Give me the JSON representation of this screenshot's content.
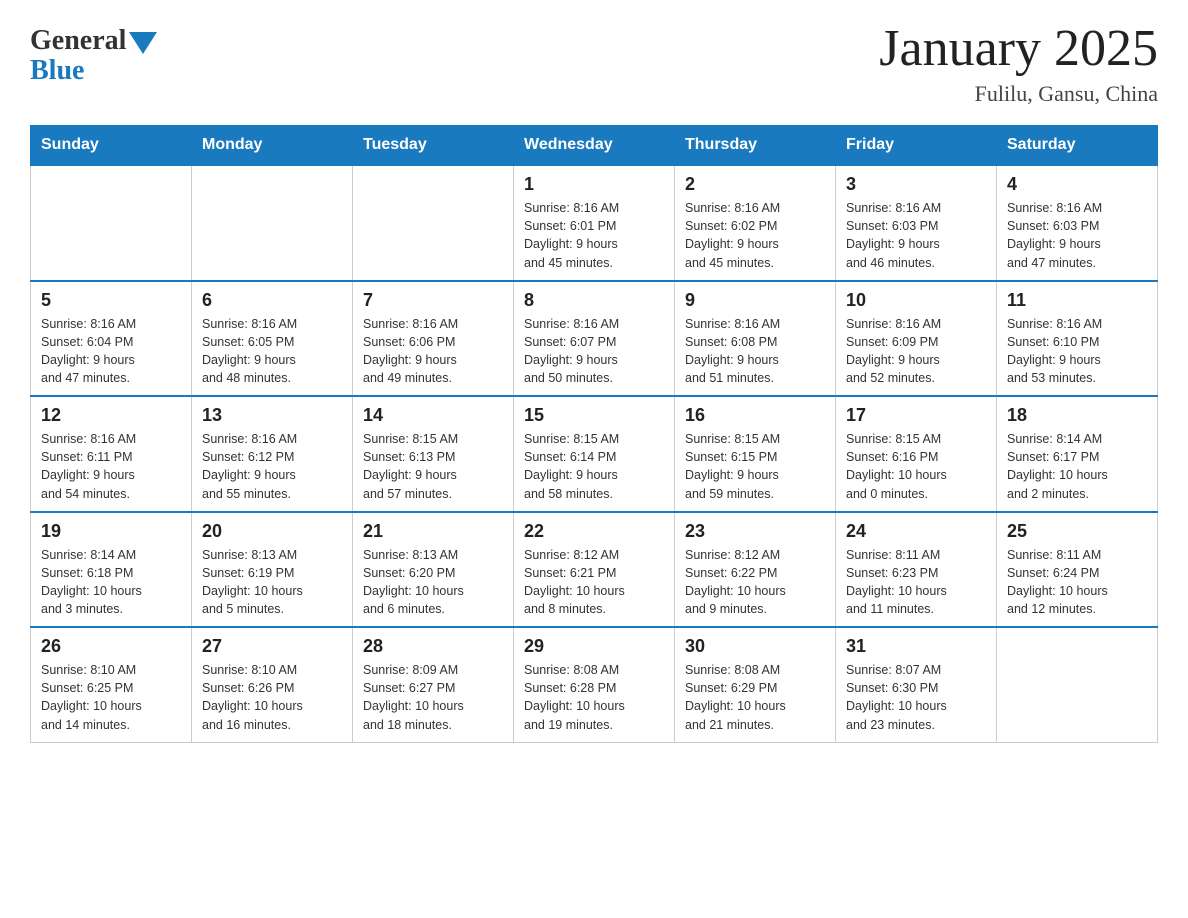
{
  "header": {
    "logo_general": "General",
    "logo_blue": "Blue",
    "month_title": "January 2025",
    "location": "Fulilu, Gansu, China"
  },
  "days_of_week": [
    "Sunday",
    "Monday",
    "Tuesday",
    "Wednesday",
    "Thursday",
    "Friday",
    "Saturday"
  ],
  "weeks": [
    [
      {
        "day": "",
        "info": ""
      },
      {
        "day": "",
        "info": ""
      },
      {
        "day": "",
        "info": ""
      },
      {
        "day": "1",
        "info": "Sunrise: 8:16 AM\nSunset: 6:01 PM\nDaylight: 9 hours\nand 45 minutes."
      },
      {
        "day": "2",
        "info": "Sunrise: 8:16 AM\nSunset: 6:02 PM\nDaylight: 9 hours\nand 45 minutes."
      },
      {
        "day": "3",
        "info": "Sunrise: 8:16 AM\nSunset: 6:03 PM\nDaylight: 9 hours\nand 46 minutes."
      },
      {
        "day": "4",
        "info": "Sunrise: 8:16 AM\nSunset: 6:03 PM\nDaylight: 9 hours\nand 47 minutes."
      }
    ],
    [
      {
        "day": "5",
        "info": "Sunrise: 8:16 AM\nSunset: 6:04 PM\nDaylight: 9 hours\nand 47 minutes."
      },
      {
        "day": "6",
        "info": "Sunrise: 8:16 AM\nSunset: 6:05 PM\nDaylight: 9 hours\nand 48 minutes."
      },
      {
        "day": "7",
        "info": "Sunrise: 8:16 AM\nSunset: 6:06 PM\nDaylight: 9 hours\nand 49 minutes."
      },
      {
        "day": "8",
        "info": "Sunrise: 8:16 AM\nSunset: 6:07 PM\nDaylight: 9 hours\nand 50 minutes."
      },
      {
        "day": "9",
        "info": "Sunrise: 8:16 AM\nSunset: 6:08 PM\nDaylight: 9 hours\nand 51 minutes."
      },
      {
        "day": "10",
        "info": "Sunrise: 8:16 AM\nSunset: 6:09 PM\nDaylight: 9 hours\nand 52 minutes."
      },
      {
        "day": "11",
        "info": "Sunrise: 8:16 AM\nSunset: 6:10 PM\nDaylight: 9 hours\nand 53 minutes."
      }
    ],
    [
      {
        "day": "12",
        "info": "Sunrise: 8:16 AM\nSunset: 6:11 PM\nDaylight: 9 hours\nand 54 minutes."
      },
      {
        "day": "13",
        "info": "Sunrise: 8:16 AM\nSunset: 6:12 PM\nDaylight: 9 hours\nand 55 minutes."
      },
      {
        "day": "14",
        "info": "Sunrise: 8:15 AM\nSunset: 6:13 PM\nDaylight: 9 hours\nand 57 minutes."
      },
      {
        "day": "15",
        "info": "Sunrise: 8:15 AM\nSunset: 6:14 PM\nDaylight: 9 hours\nand 58 minutes."
      },
      {
        "day": "16",
        "info": "Sunrise: 8:15 AM\nSunset: 6:15 PM\nDaylight: 9 hours\nand 59 minutes."
      },
      {
        "day": "17",
        "info": "Sunrise: 8:15 AM\nSunset: 6:16 PM\nDaylight: 10 hours\nand 0 minutes."
      },
      {
        "day": "18",
        "info": "Sunrise: 8:14 AM\nSunset: 6:17 PM\nDaylight: 10 hours\nand 2 minutes."
      }
    ],
    [
      {
        "day": "19",
        "info": "Sunrise: 8:14 AM\nSunset: 6:18 PM\nDaylight: 10 hours\nand 3 minutes."
      },
      {
        "day": "20",
        "info": "Sunrise: 8:13 AM\nSunset: 6:19 PM\nDaylight: 10 hours\nand 5 minutes."
      },
      {
        "day": "21",
        "info": "Sunrise: 8:13 AM\nSunset: 6:20 PM\nDaylight: 10 hours\nand 6 minutes."
      },
      {
        "day": "22",
        "info": "Sunrise: 8:12 AM\nSunset: 6:21 PM\nDaylight: 10 hours\nand 8 minutes."
      },
      {
        "day": "23",
        "info": "Sunrise: 8:12 AM\nSunset: 6:22 PM\nDaylight: 10 hours\nand 9 minutes."
      },
      {
        "day": "24",
        "info": "Sunrise: 8:11 AM\nSunset: 6:23 PM\nDaylight: 10 hours\nand 11 minutes."
      },
      {
        "day": "25",
        "info": "Sunrise: 8:11 AM\nSunset: 6:24 PM\nDaylight: 10 hours\nand 12 minutes."
      }
    ],
    [
      {
        "day": "26",
        "info": "Sunrise: 8:10 AM\nSunset: 6:25 PM\nDaylight: 10 hours\nand 14 minutes."
      },
      {
        "day": "27",
        "info": "Sunrise: 8:10 AM\nSunset: 6:26 PM\nDaylight: 10 hours\nand 16 minutes."
      },
      {
        "day": "28",
        "info": "Sunrise: 8:09 AM\nSunset: 6:27 PM\nDaylight: 10 hours\nand 18 minutes."
      },
      {
        "day": "29",
        "info": "Sunrise: 8:08 AM\nSunset: 6:28 PM\nDaylight: 10 hours\nand 19 minutes."
      },
      {
        "day": "30",
        "info": "Sunrise: 8:08 AM\nSunset: 6:29 PM\nDaylight: 10 hours\nand 21 minutes."
      },
      {
        "day": "31",
        "info": "Sunrise: 8:07 AM\nSunset: 6:30 PM\nDaylight: 10 hours\nand 23 minutes."
      },
      {
        "day": "",
        "info": ""
      }
    ]
  ]
}
